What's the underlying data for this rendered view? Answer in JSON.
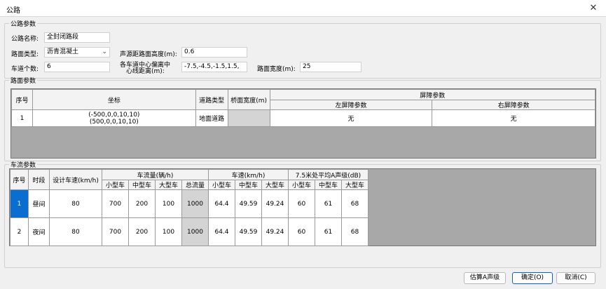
{
  "window": {
    "title": "公路",
    "close_glyph": "✕"
  },
  "road_params": {
    "legend": "公路参数",
    "name_label": "公路名称:",
    "name_value": "全封闭路段",
    "surface_label": "路面类型:",
    "surface_value": "沥青混凝土",
    "source_height_label": "声源距路面高度(m):",
    "source_height_value": "0.6",
    "lanes_label": "车道个数:",
    "lanes_value": "6",
    "lane_dist_label_1": "各车道中心偏离中",
    "lane_dist_label_2": "心线距离(m):",
    "lane_dist_value": "-7.5,-4.5,-1.5,1.5,",
    "width_label": "路面宽度(m):",
    "width_value": "25"
  },
  "surface_table": {
    "legend": "路面参数",
    "headers": {
      "index": "序号",
      "coords": "坐标",
      "road_type": "道路类型",
      "deck_width": "桥面宽度(m)",
      "barrier": "屏障参数",
      "left_barrier": "左屏障参数",
      "right_barrier": "右屏障参数"
    },
    "rows": [
      {
        "index": "1",
        "coord_1": "(-500,0,0,10,10)",
        "coord_2": "(500,0,0,10,10)",
        "road_type": "地面道路",
        "deck_width": "",
        "left": "无",
        "right": "无"
      }
    ]
  },
  "traffic_table": {
    "legend": "车流参数",
    "headers": {
      "index": "序号",
      "period": "时段",
      "design_speed": "设计车速(km/h)",
      "flow": "车流量(辆/h)",
      "speed": "车速(km/h)",
      "level": "7.5米处平均A声级(dB)",
      "small": "小型车",
      "medium": "中型车",
      "large": "大型车",
      "total": "总流量"
    },
    "rows": [
      {
        "index": "1",
        "period": "昼间",
        "design_speed": "80",
        "flow_small": "700",
        "flow_medium": "200",
        "flow_large": "100",
        "flow_total": "1000",
        "speed_small": "64.4",
        "speed_medium": "49.59",
        "speed_large": "49.24",
        "level_small": "60",
        "level_medium": "61",
        "level_large": "68"
      },
      {
        "index": "2",
        "period": "夜间",
        "design_speed": "80",
        "flow_small": "700",
        "flow_medium": "200",
        "flow_large": "100",
        "flow_total": "1000",
        "speed_small": "64.4",
        "speed_medium": "49.59",
        "speed_large": "49.24",
        "level_small": "60",
        "level_medium": "61",
        "level_large": "68"
      }
    ]
  },
  "buttons": {
    "estimate": "估算A声级",
    "ok": "确定(O)",
    "cancel": "取消(C)"
  },
  "colors": {
    "selection": "#0a6ed1",
    "table_background": "#a8a8a8",
    "primary_border": "#0a64c8"
  }
}
